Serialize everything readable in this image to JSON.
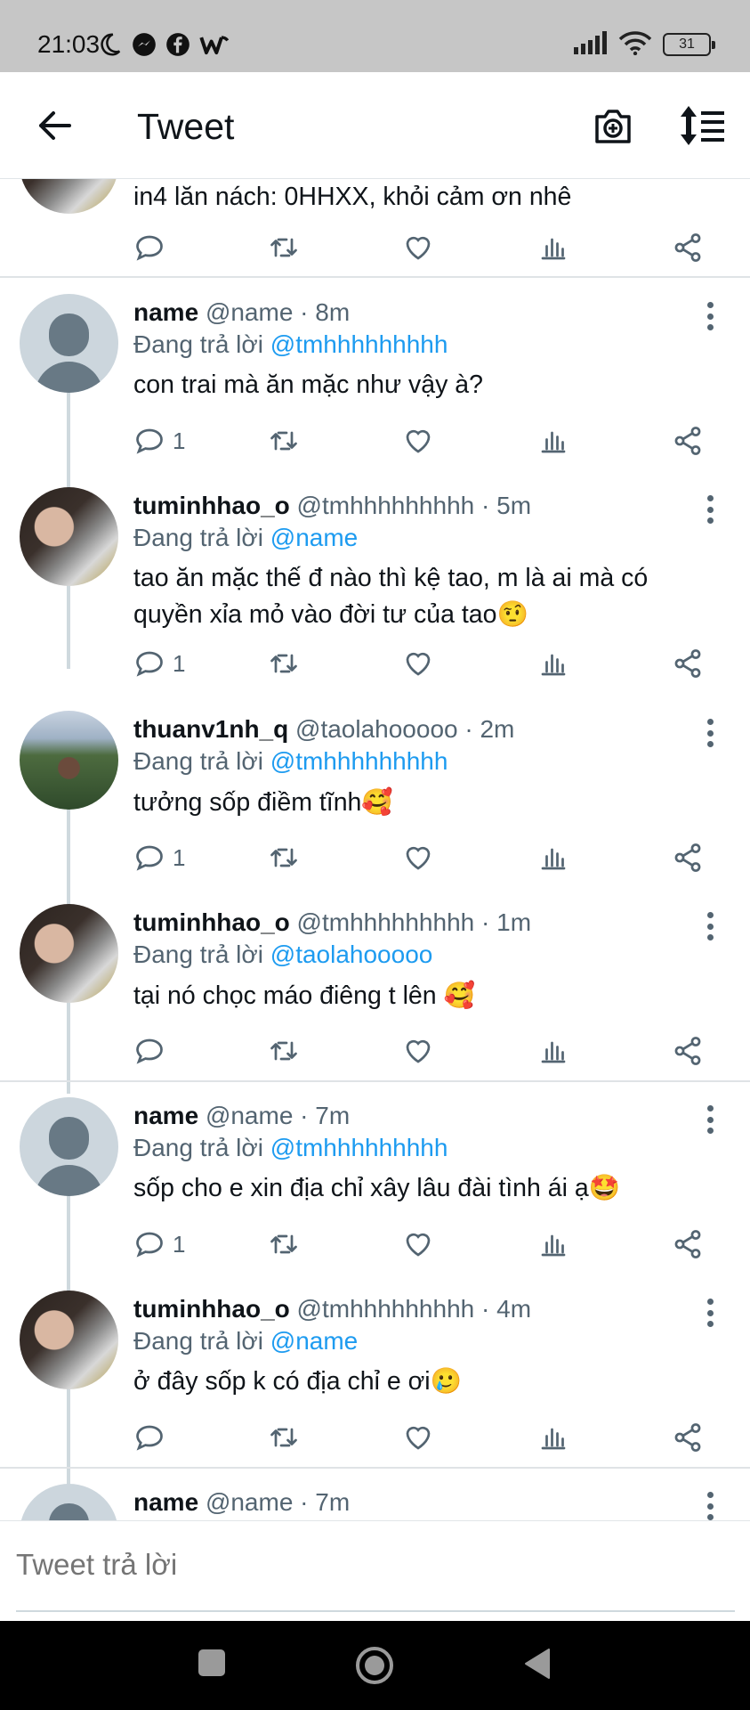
{
  "status_bar": {
    "time": "21:03",
    "battery": "31",
    "icons": [
      "moon-icon",
      "messenger-icon",
      "facebook-icon",
      "w-app-icon",
      "signal-icon",
      "wifi-icon",
      "battery-icon"
    ]
  },
  "header": {
    "title": "Tweet",
    "icons": [
      "back-arrow-icon",
      "camera-plus-icon",
      "sort-icon"
    ]
  },
  "top_partial_tweet": {
    "text": "in4 lăn nách: 0HHXX, khỏi cảm ơn nhê"
  },
  "reply_prefix": "Đang trả lời",
  "tweets": [
    {
      "name": "name",
      "handle": "@name",
      "time": "8m",
      "reply_to": "@tmhhhhhhhhh",
      "text": "con trai mà ăn mặc như vậy à?",
      "reply_count": "1"
    },
    {
      "name": "tuminhhao_o",
      "handle": "@tmhhhhhhhhh",
      "time": "5m",
      "reply_to": "@name",
      "text": "tao ăn mặc thế đ nào thì kệ tao, m là ai mà có quyền xỉa mỏ vào đời tư của tao🤨",
      "reply_count": "1"
    },
    {
      "name": "thuanv1nh_q",
      "handle": "@taolahooooo",
      "time": "2m",
      "reply_to": "@tmhhhhhhhhh",
      "text": "tưởng sốp điềm tĩnh🥰",
      "reply_count": "1"
    },
    {
      "name": "tuminhhao_o",
      "handle": "@tmhhhhhhhhh",
      "time": "1m",
      "reply_to": "@taolahooooo",
      "text": "tại nó chọc máo điêng t lên 🥰",
      "reply_count": ""
    },
    {
      "name": "name",
      "handle": "@name",
      "time": "7m",
      "reply_to": "@tmhhhhhhhhh",
      "text": "sốp cho e xin địa chỉ xây lâu đài tình ái ạ🤩",
      "reply_count": "1"
    },
    {
      "name": "tuminhhao_o",
      "handle": "@tmhhhhhhhhh",
      "time": "4m",
      "reply_to": "@name",
      "text": "ở đây sốp k có địa chỉ e ơi🥲",
      "reply_count": ""
    },
    {
      "name": "name",
      "handle": "@name",
      "time": "7m"
    }
  ],
  "reply_bar": {
    "placeholder": "Tweet trả lời"
  },
  "nav_bar": {
    "icons": [
      "recents-square-icon",
      "home-circle-icon",
      "back-triangle-icon"
    ]
  }
}
